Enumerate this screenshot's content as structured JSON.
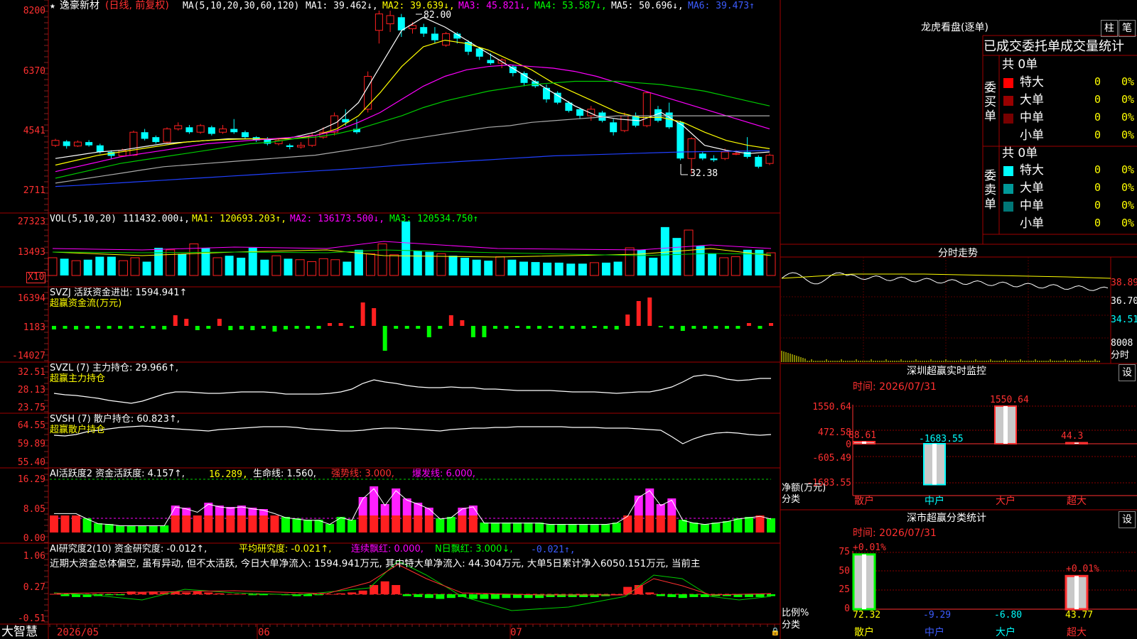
{
  "colors": {
    "up": "#ff2020",
    "down": "#00ffff",
    "frame": "#a00000",
    "bg": "#000000"
  },
  "header": {
    "star": "★",
    "title": "逸豪新材",
    "mode": "(日线, 前复权)",
    "ma_head": "MA(5,10,20,30,60,120)",
    "ma1": "MA1: 39.462↓,",
    "ma2": "MA2: 39.639↓,",
    "ma3": "MA3: 45.821↓,",
    "ma4": "MA4: 53.587↓,",
    "ma5": "MA5: 50.696↓,",
    "ma6": "MA6: 39.473↑"
  },
  "price_axis": [
    "8200",
    "6370",
    "4541",
    "2711"
  ],
  "price_notes": {
    "high": "82.00",
    "low": "32.38"
  },
  "vol": {
    "head": "VOL(5,10,20)",
    "value": "111432.000↓,",
    "ma1": "MA1: 120693.203↑,",
    "ma2": "MA2: 136173.500↓,",
    "ma3": "MA3: 120534.750↑",
    "axis": [
      "27323",
      "13493"
    ],
    "unit": "X10"
  },
  "svzj": {
    "head": "SVZJ  活跃资金进出: 1594.941↑",
    "sub": "超赢资金流(万元)",
    "axis": [
      "16394",
      "1183",
      "-14027"
    ]
  },
  "svzl": {
    "head": "SVZL (7) 主力持仓: 29.966↑,",
    "sub": "超赢主力持仓",
    "axis": [
      "32.51",
      "28.13",
      "23.75"
    ]
  },
  "svsh": {
    "head": "SVSH (7) 散户持仓: 60.823↑,",
    "sub": "超赢散户持仓",
    "axis": [
      "64.55",
      "59.89",
      "55.40"
    ]
  },
  "ai1": {
    "head": "AI活跃度2 资金活跃度: 4.157↑,",
    "v2": "16.289,",
    "v3": "生命线: 1.560,",
    "v4": "强势线: 3.000,",
    "v5": "爆发线: 6.000,",
    "axis": [
      "16.29",
      "8.05",
      "0.00"
    ]
  },
  "ai2": {
    "head": "AI研究度2(10) 资金研究度: -0.012↑,",
    "v2": "平均研究度: -0.021↑,",
    "v3": "连续飘红: 0.000,",
    "v4": "N日飘红: 3.000↓,",
    "v5": "-0.021↑,",
    "text": "近期大资金总体偏空, 虽有异动, 但不太活跃, 今日大单净流入: 1594.941万元, 其中特大单净流入: 44.304万元, 大单5日累计净入6050.151万元, 当前主",
    "axis": [
      "1.06",
      "0.27",
      "-0.51"
    ]
  },
  "date_axis": {
    "brand": "大智慧",
    "labels": [
      "2026/05",
      "06",
      "07"
    ]
  },
  "dragon": {
    "title": "龙虎看盘(逐单)",
    "btn1": "柱",
    "btn2": "笔",
    "tabs": "已成交委托单成交量统计",
    "buy_label": "委买单",
    "sell_label": "委卖单",
    "buy_total": "共 0单",
    "sell_total": "共 0单",
    "rows": [
      {
        "name": "特大",
        "count": "0",
        "pct": "0%"
      },
      {
        "name": "大单",
        "count": "0",
        "pct": "0%"
      },
      {
        "name": "中单",
        "count": "0",
        "pct": "0%"
      },
      {
        "name": "小单",
        "count": "0",
        "pct": "0%"
      }
    ]
  },
  "minute": {
    "title": "分时走势",
    "axis": [
      "38.89",
      "36.70",
      "34.51",
      "8008"
    ],
    "unit": "分时"
  },
  "sz": {
    "title": "深圳超赢实时监控",
    "btn": "设",
    "time": "时间: 2026/07/31",
    "axis": [
      "1550.64",
      "472.58",
      "0",
      "-605.49",
      "-1683.55"
    ],
    "ylabel": "净额(万元)",
    "xlabel": "分类",
    "cats": [
      "散户",
      "中户",
      "大户",
      "超大"
    ],
    "bar_labels": [
      "88.61",
      "-1683.55",
      "1550.64",
      "44.3"
    ],
    "values": [
      88.61,
      -1683.55,
      1550.64,
      44.3
    ]
  },
  "szcls": {
    "title": "深市超赢分类统计",
    "btn": "设",
    "time": "时间: 2026/07/31",
    "axis": [
      "75",
      "50",
      "25",
      "0"
    ],
    "ylabel": "比例%",
    "xlabel": "分类",
    "top_labels": [
      "+0.01%",
      "+0.01%"
    ],
    "cats": [
      "散户",
      "中户",
      "大户",
      "超大"
    ],
    "values": [
      "72.32",
      "-9.29",
      "-6.80",
      "43.77"
    ]
  }
}
